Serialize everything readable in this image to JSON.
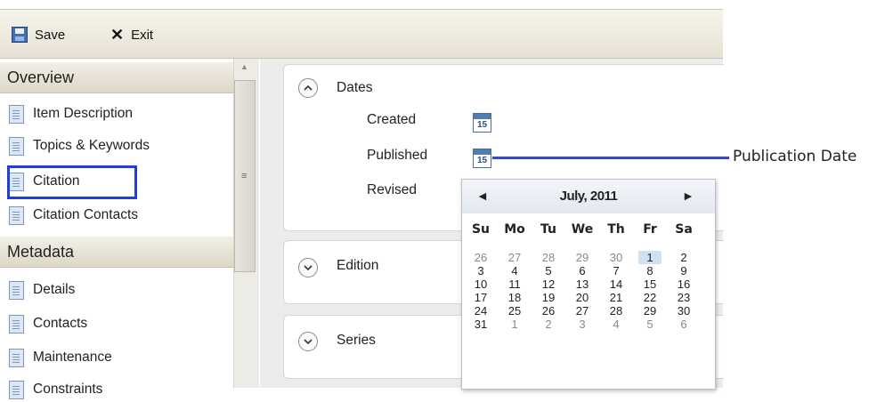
{
  "toolbar": {
    "save_label": "Save",
    "exit_label": "Exit",
    "exit_glyph": "✕"
  },
  "sidebar": {
    "sections": [
      {
        "title": "Overview",
        "items": [
          "Item Description",
          "Topics & Keywords",
          "Citation",
          "Citation Contacts"
        ]
      },
      {
        "title": "Metadata",
        "items": [
          "Details",
          "Contacts",
          "Maintenance",
          "Constraints"
        ]
      }
    ],
    "selected_item": "Citation"
  },
  "panels": {
    "dates": {
      "title": "Dates",
      "expanded": true,
      "fields": [
        {
          "label": "Created",
          "icon": "calendar-icon",
          "day": "15"
        },
        {
          "label": "Published",
          "icon": "calendar-icon",
          "day": "15"
        },
        {
          "label": "Revised"
        }
      ]
    },
    "edition": {
      "title": "Edition",
      "expanded": false
    },
    "series": {
      "title": "Series",
      "expanded": false
    }
  },
  "callout": {
    "label": "Publication Date",
    "color": "#3a49c9"
  },
  "calendar": {
    "month": "July, 2011",
    "prev_glyph": "◄",
    "next_glyph": "►",
    "weekdays": [
      "Su",
      "Mo",
      "Tu",
      "We",
      "Th",
      "Fr",
      "Sa"
    ],
    "weeks": [
      [
        "26",
        "27",
        "28",
        "29",
        "30",
        "1",
        "2"
      ],
      [
        "3",
        "4",
        "5",
        "6",
        "7",
        "8",
        "9"
      ],
      [
        "10",
        "11",
        "12",
        "13",
        "14",
        "15",
        "16"
      ],
      [
        "17",
        "18",
        "19",
        "20",
        "21",
        "22",
        "23"
      ],
      [
        "24",
        "25",
        "26",
        "27",
        "28",
        "29",
        "30"
      ],
      [
        "31",
        "1",
        "2",
        "3",
        "4",
        "5",
        "6"
      ]
    ],
    "selected_day": "1"
  }
}
